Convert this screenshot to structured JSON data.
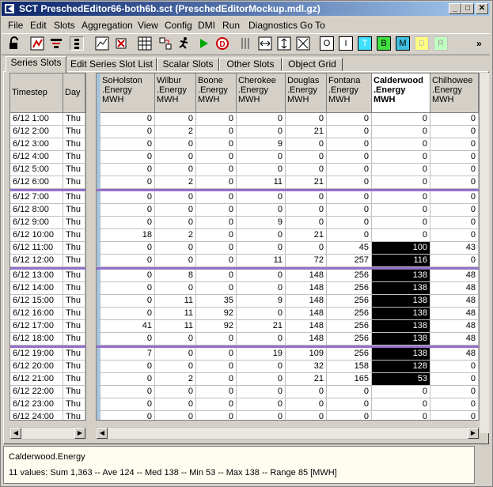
{
  "window": {
    "title": "SCT PreschedEditor66-both6b.sct (PreschedEditorMockup.mdl.gz)"
  },
  "menu": [
    "File",
    "Edit",
    "Slots",
    "Aggregation",
    "View",
    "Config",
    "DMI",
    "Run",
    "Diagnostics",
    "Go To"
  ],
  "toolbar_letters": [
    "O",
    "I",
    "T",
    "B",
    "M",
    "D",
    "R"
  ],
  "toolbar_colors": [
    "#ffffff",
    "#ffffff",
    "#40e0ff",
    "#40e040",
    "#40c0e0",
    "#ffff80",
    "#c0ffc0"
  ],
  "tabs": [
    "Series Slots",
    "Edit Series Slot List",
    "Scalar Slots",
    "Other Slots",
    "Object Grid"
  ],
  "left_headers": [
    "Timestep",
    "Day"
  ],
  "columns": [
    {
      "l1": "SoHolston",
      "l2": ".Energy",
      "l3": "MWH"
    },
    {
      "l1": "Wilbur",
      "l2": ".Energy",
      "l3": "MWH"
    },
    {
      "l1": "Boone",
      "l2": ".Energy",
      "l3": "MWH"
    },
    {
      "l1": "Cherokee",
      "l2": ".Energy",
      "l3": "MWH"
    },
    {
      "l1": "Douglas",
      "l2": ".Energy",
      "l3": "MWH"
    },
    {
      "l1": "Fontana",
      "l2": ".Energy",
      "l3": "MWH"
    },
    {
      "l1": "Calderwood",
      "l2": ".Energy",
      "l3": "MWH"
    },
    {
      "l1": "Chilhowee",
      "l2": ".Energy",
      "l3": "MWH"
    }
  ],
  "rows": [
    {
      "t": "6/12 1:00",
      "d": "Thu",
      "v": [
        "0",
        "0",
        "0",
        "0",
        "0",
        "0",
        "0",
        "0"
      ]
    },
    {
      "t": "6/12 2:00",
      "d": "Thu",
      "v": [
        "0",
        "2",
        "0",
        "0",
        "21",
        "0",
        "0",
        "0"
      ]
    },
    {
      "t": "6/12 3:00",
      "d": "Thu",
      "v": [
        "0",
        "0",
        "0",
        "9",
        "0",
        "0",
        "0",
        "0"
      ]
    },
    {
      "t": "6/12 4:00",
      "d": "Thu",
      "v": [
        "0",
        "0",
        "0",
        "0",
        "0",
        "0",
        "0",
        "0"
      ]
    },
    {
      "t": "6/12 5:00",
      "d": "Thu",
      "v": [
        "0",
        "0",
        "0",
        "0",
        "0",
        "0",
        "0",
        "0"
      ]
    },
    {
      "t": "6/12 6:00",
      "d": "Thu",
      "v": [
        "0",
        "2",
        "0",
        "11",
        "21",
        "0",
        "0",
        "0"
      ]
    },
    {
      "t": "6/12 7:00",
      "d": "Thu",
      "v": [
        "0",
        "0",
        "0",
        "0",
        "0",
        "0",
        "0",
        "0"
      ]
    },
    {
      "t": "6/12 8:00",
      "d": "Thu",
      "v": [
        "0",
        "0",
        "0",
        "0",
        "0",
        "0",
        "0",
        "0"
      ]
    },
    {
      "t": "6/12 9:00",
      "d": "Thu",
      "v": [
        "0",
        "0",
        "0",
        "9",
        "0",
        "0",
        "0",
        "0"
      ]
    },
    {
      "t": "6/12 10:00",
      "d": "Thu",
      "v": [
        "18",
        "2",
        "0",
        "0",
        "21",
        "0",
        "0",
        "0"
      ]
    },
    {
      "t": "6/12 11:00",
      "d": "Thu",
      "v": [
        "0",
        "0",
        "0",
        "0",
        "0",
        "45",
        "100",
        "43"
      ]
    },
    {
      "t": "6/12 12:00",
      "d": "Thu",
      "v": [
        "0",
        "0",
        "0",
        "11",
        "72",
        "257",
        "116",
        "0"
      ]
    },
    {
      "t": "6/12 13:00",
      "d": "Thu",
      "v": [
        "0",
        "8",
        "0",
        "0",
        "148",
        "256",
        "138",
        "48"
      ]
    },
    {
      "t": "6/12 14:00",
      "d": "Thu",
      "v": [
        "0",
        "0",
        "0",
        "0",
        "148",
        "256",
        "138",
        "48"
      ]
    },
    {
      "t": "6/12 15:00",
      "d": "Thu",
      "v": [
        "0",
        "11",
        "35",
        "9",
        "148",
        "256",
        "138",
        "48"
      ]
    },
    {
      "t": "6/12 16:00",
      "d": "Thu",
      "v": [
        "0",
        "11",
        "92",
        "0",
        "148",
        "256",
        "138",
        "48"
      ]
    },
    {
      "t": "6/12 17:00",
      "d": "Thu",
      "v": [
        "41",
        "11",
        "92",
        "21",
        "148",
        "256",
        "138",
        "48"
      ]
    },
    {
      "t": "6/12 18:00",
      "d": "Thu",
      "v": [
        "0",
        "0",
        "0",
        "0",
        "148",
        "256",
        "138",
        "48"
      ]
    },
    {
      "t": "6/12 19:00",
      "d": "Thu",
      "v": [
        "7",
        "0",
        "0",
        "19",
        "109",
        "256",
        "138",
        "48"
      ]
    },
    {
      "t": "6/12 20:00",
      "d": "Thu",
      "v": [
        "0",
        "0",
        "0",
        "0",
        "32",
        "158",
        "128",
        "0"
      ]
    },
    {
      "t": "6/12 21:00",
      "d": "Thu",
      "v": [
        "0",
        "2",
        "0",
        "0",
        "21",
        "165",
        "53",
        "0"
      ]
    },
    {
      "t": "6/12 22:00",
      "d": "Thu",
      "v": [
        "0",
        "0",
        "0",
        "0",
        "0",
        "0",
        "0",
        "0"
      ]
    },
    {
      "t": "6/12 23:00",
      "d": "Thu",
      "v": [
        "0",
        "0",
        "0",
        "0",
        "0",
        "0",
        "0",
        "0"
      ]
    },
    {
      "t": "6/12 24:00",
      "d": "Thu",
      "v": [
        "0",
        "0",
        "0",
        "0",
        "0",
        "0",
        "0",
        "0"
      ]
    }
  ],
  "selected_column": 6,
  "selected_rows": [
    10,
    11,
    12,
    13,
    14,
    15,
    16,
    17,
    18,
    19,
    20
  ],
  "separator_after_rows": [
    5,
    11,
    17
  ],
  "status": {
    "line1": "Calderwood.Energy",
    "line2": "11 values:  Sum 1,363 -- Ave 124 -- Med 138 -- Min 53 -- Max 138 -- Range 85 [MWH]"
  },
  "colors": {
    "separator": "#9370c8",
    "end_separator": "#8b1a1a",
    "selection": "#000000",
    "title_start": "#0a246a",
    "title_end": "#a6caf0"
  }
}
